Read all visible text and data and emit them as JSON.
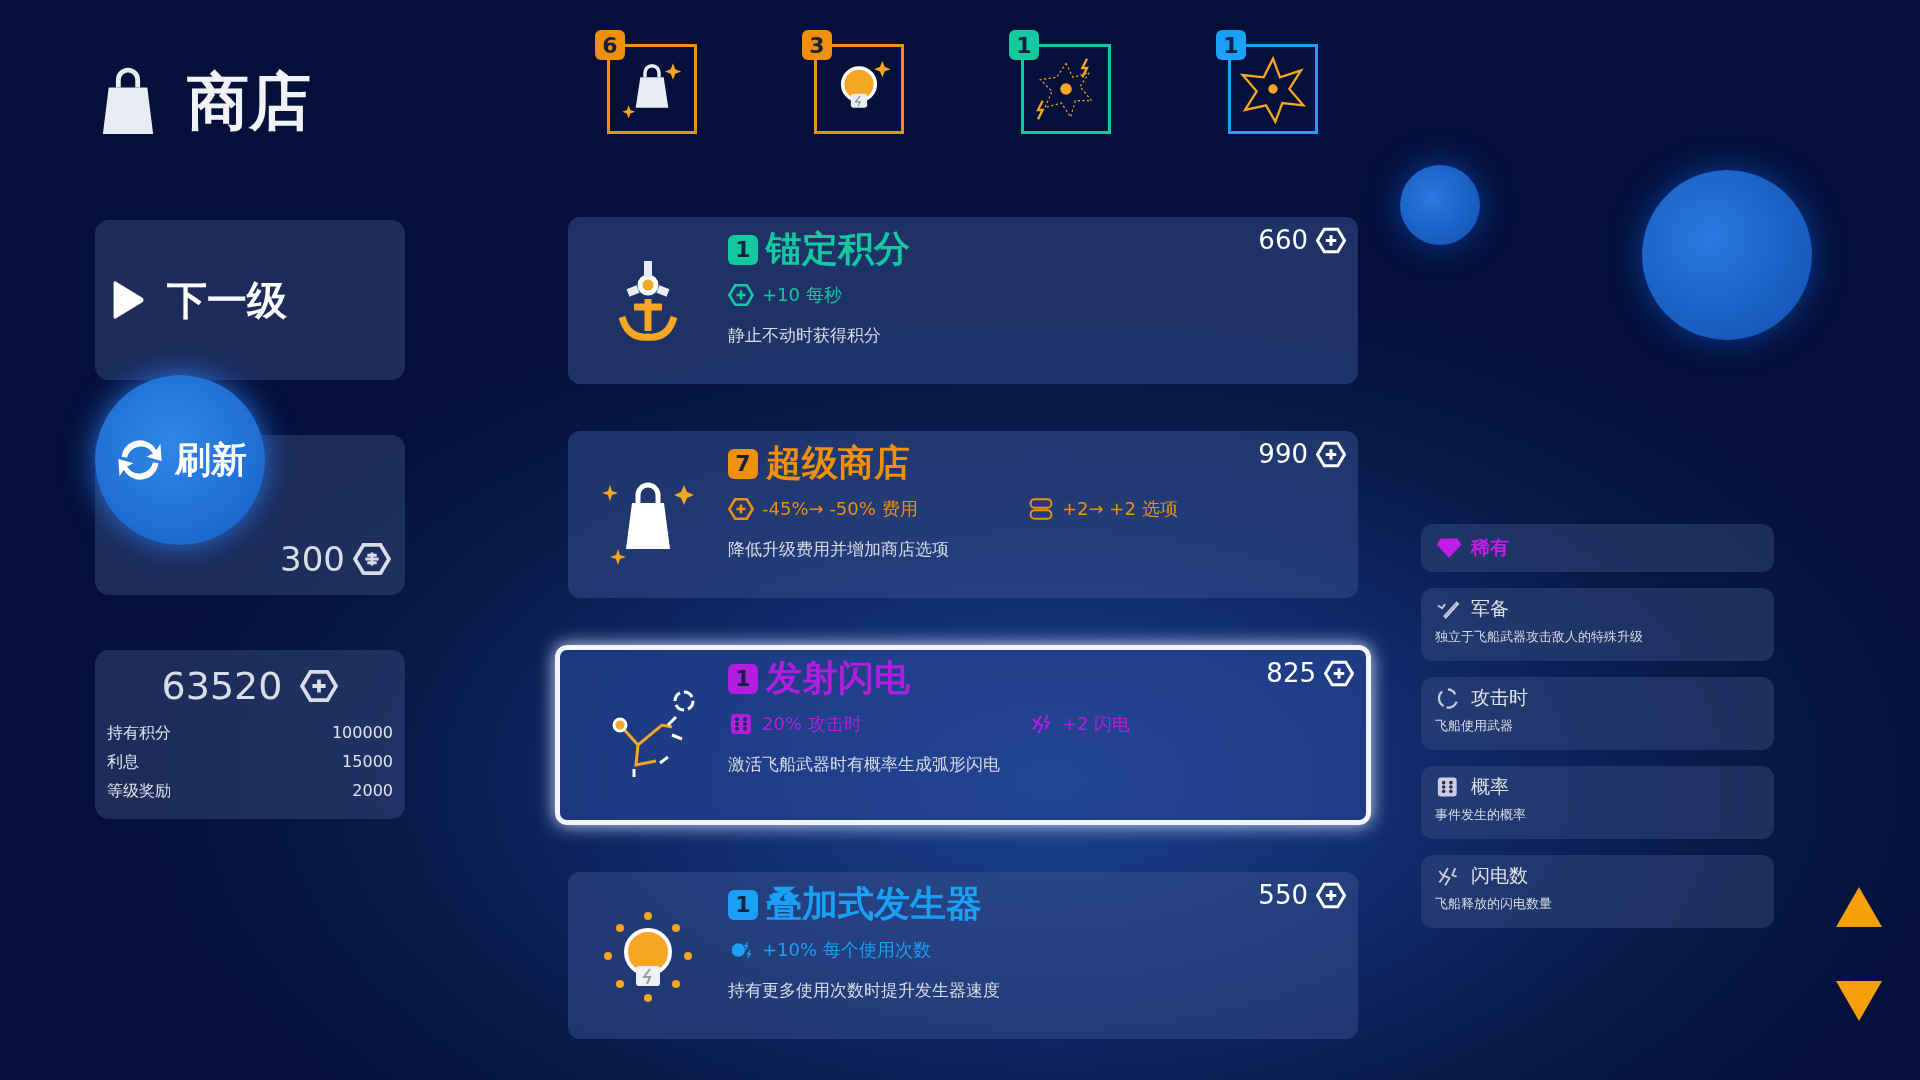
{
  "title": "商店",
  "next_level": {
    "label": "下一级"
  },
  "refresh": {
    "label": "刷新",
    "cost": "300"
  },
  "balance": {
    "total": "63520",
    "rows": [
      {
        "label": "持有积分",
        "value": "100000"
      },
      {
        "label": "利息",
        "value": "15000"
      },
      {
        "label": "等级奖励",
        "value": "2000"
      }
    ]
  },
  "upgrade_slots": [
    {
      "count": "6",
      "color": "#f0900a",
      "kind": "bag"
    },
    {
      "count": "3",
      "color": "#f0900a",
      "kind": "generator"
    },
    {
      "count": "1",
      "color": "#12c9a0",
      "kind": "lightning"
    },
    {
      "count": "1",
      "color": "#1aa0f5",
      "kind": "star"
    }
  ],
  "shop_items": [
    {
      "level": "1",
      "name": "锚定积分",
      "color": "#12c9a0",
      "price": "660",
      "kind": "anchor",
      "selected": false,
      "effects": [
        {
          "kind": "coin",
          "text": "+10 每秒"
        }
      ],
      "description": "静止不动时获得积分"
    },
    {
      "level": "7",
      "name": "超级商店",
      "color": "#f0900a",
      "price": "990",
      "kind": "bag",
      "selected": false,
      "effects": [
        {
          "kind": "coin",
          "text": "-45%→ -50% 费用"
        },
        {
          "kind": "options",
          "text": "+2→ +2 选项"
        }
      ],
      "description": "降低升级费用并增加商店选项"
    },
    {
      "level": "1",
      "name": "发射闪电",
      "color": "#b11ee0",
      "price": "825",
      "kind": "lightning",
      "selected": true,
      "effects": [
        {
          "kind": "dice",
          "text": "20% 攻击时"
        },
        {
          "kind": "lightning",
          "text": "+2 闪电"
        }
      ],
      "description": "激活飞船武器时有概率生成弧形闪电"
    },
    {
      "level": "1",
      "name": "叠加式发生器",
      "color": "#1aa0f5",
      "price": "550",
      "kind": "generator",
      "selected": false,
      "effects": [
        {
          "kind": "generator",
          "text": "+10% 每个使用次数"
        }
      ],
      "description": "持有更多使用次数时提升发生器速度"
    }
  ],
  "legend": {
    "rarity": {
      "label": "稀有",
      "color": "#c21ee8"
    },
    "tags": [
      {
        "kind": "weapon",
        "name": "军备",
        "description": "独立于飞船武器攻击敌人的特殊升级"
      },
      {
        "kind": "attack",
        "name": "攻击时",
        "description": "飞船使用武器"
      },
      {
        "kind": "dice",
        "name": "概率",
        "description": "事件发生的概率"
      },
      {
        "kind": "lightning",
        "name": "闪电数",
        "description": "飞船释放的闪电数量"
      }
    ]
  }
}
